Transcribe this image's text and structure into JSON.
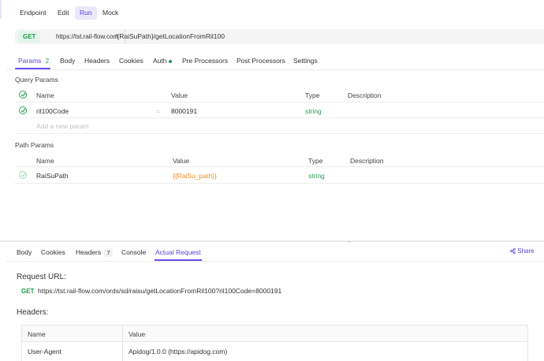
{
  "mode_tabs": [
    "Endpoint",
    "Edit",
    "Run",
    "Mock"
  ],
  "request": {
    "method": "GET",
    "base_url": "https://tst.rail-flow.com",
    "path": "/{RaiSuPath}/getLocationFromRil100"
  },
  "request_tabs": {
    "params_label": "Params",
    "params_count": "2",
    "body": "Body",
    "headers": "Headers",
    "cookies": "Cookies",
    "auth": "Auth",
    "pre": "Pre Processors",
    "post": "Post Processors",
    "settings": "Settings"
  },
  "query_params": {
    "title": "Query Params",
    "columns": {
      "name": "Name",
      "value": "Value",
      "type": "Type",
      "description": "Description"
    },
    "row": {
      "name": "ril100Code",
      "eq": "=",
      "value": "8000191",
      "type": "string"
    },
    "add_placeholder": "Add a new param"
  },
  "path_params": {
    "title": "Path Params",
    "columns": {
      "name": "Name",
      "value": "Value",
      "type": "Type",
      "description": "Description"
    },
    "row": {
      "name": "RaiSuPath",
      "value": "{{RaiSu_path}}",
      "type": "string"
    }
  },
  "splitter_grip": "...",
  "response_tabs": {
    "body": "Body",
    "cookies": "Cookies",
    "headers": "Headers",
    "headers_count": "7",
    "console": "Console",
    "actual_request": "Actual Request",
    "share": "Share"
  },
  "actual_request": {
    "request_url_label": "Request URL:",
    "method": "GET",
    "full_url": "https://tst.rail-flow.com/ords/sd/raisu/getLocationFromRil100?ril100Code=8000191",
    "headers_label": "Headers:",
    "table_columns": {
      "name": "Name",
      "value": "Value"
    },
    "rows": [
      {
        "name": "User-Agent",
        "value": "Apidog/1.0.0 (https://apidog.com)"
      }
    ]
  },
  "colors": {
    "accent": "#5b3fd6",
    "get_green": "#1e9a4f",
    "string_type": "#2a9a56",
    "variable_orange": "#f08a24"
  }
}
